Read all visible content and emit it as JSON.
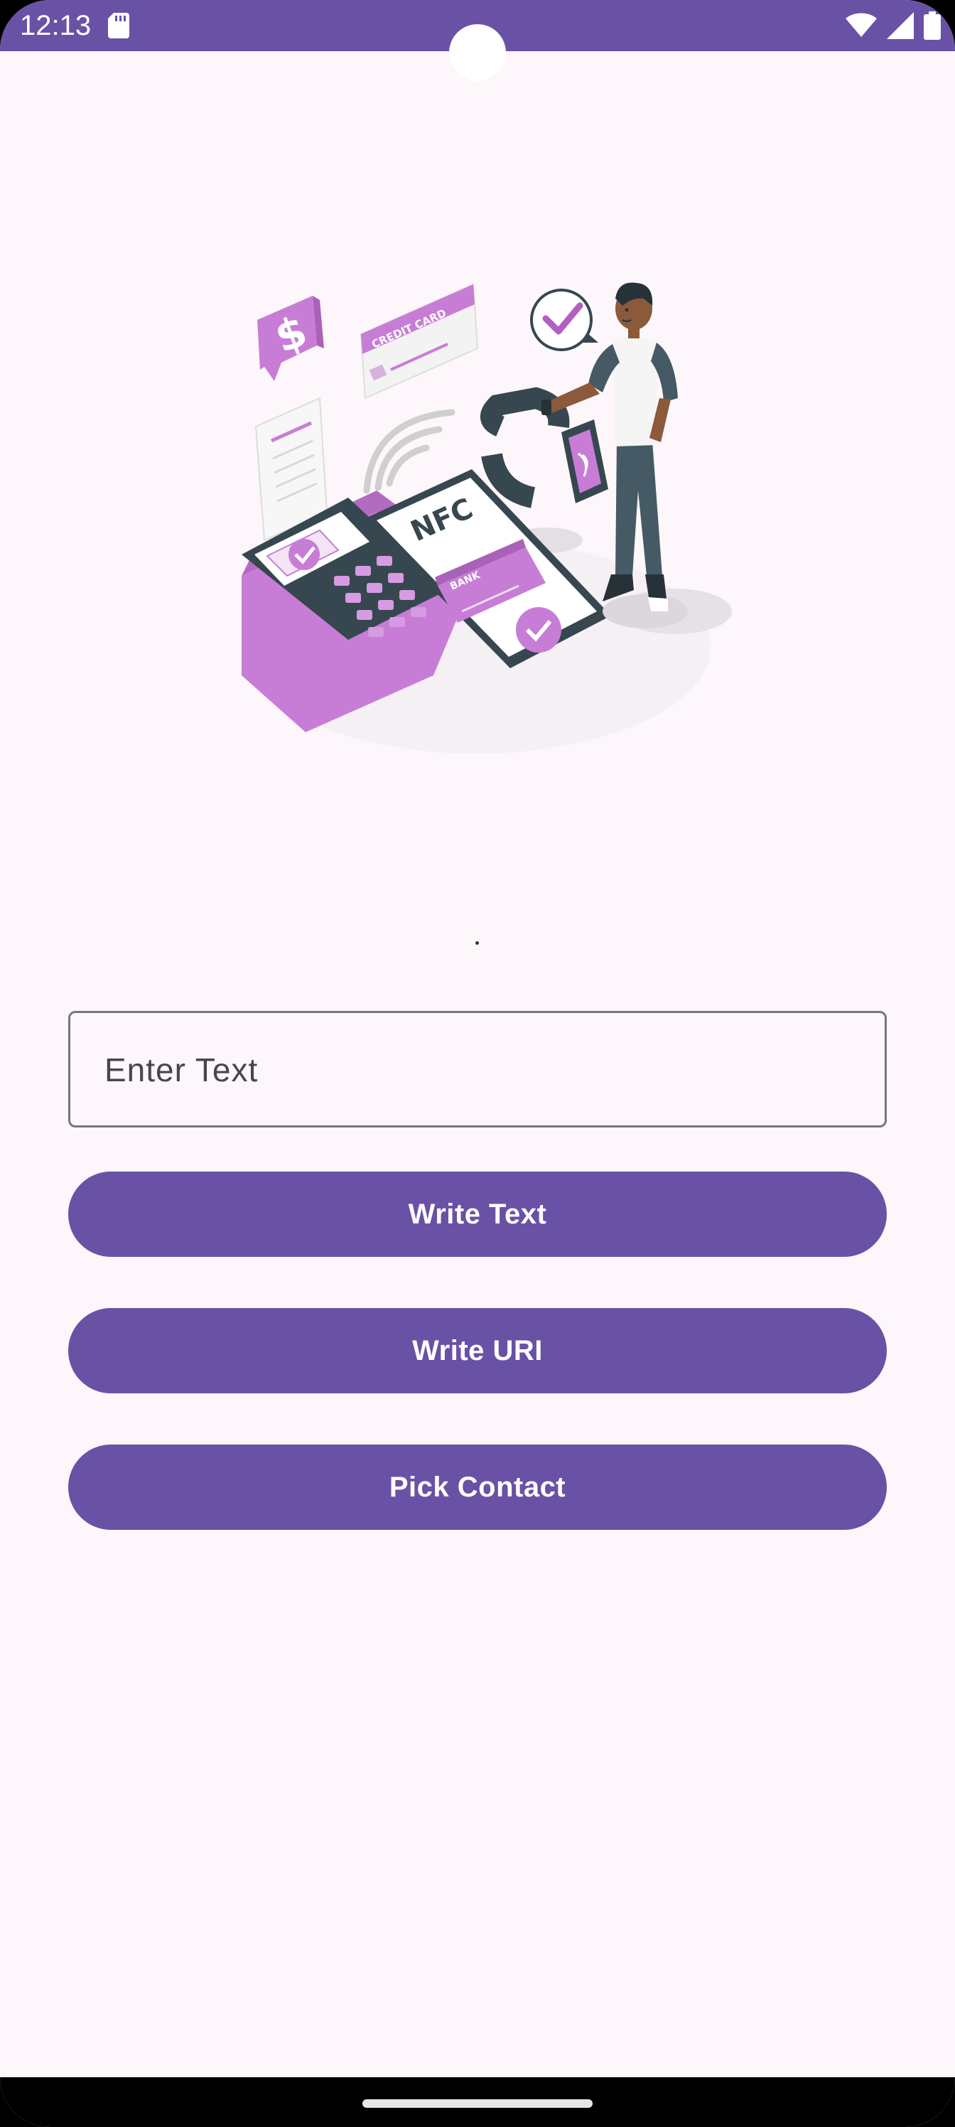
{
  "status_bar": {
    "time": "12:13",
    "icons": [
      "sd-card-icon",
      "wifi-icon",
      "signal-icon",
      "battery-icon"
    ],
    "background": "#6951a6"
  },
  "illustration": {
    "icon": "nfc-payment-illustration",
    "nfc_label": "NFC",
    "card_label": "CREDIT CARD",
    "bank_label": "BANK",
    "currency_symbol": "$"
  },
  "main": {
    "input": {
      "placeholder": "Enter Text",
      "value": ""
    },
    "buttons": {
      "write_text": "Write Text",
      "write_uri": "Write URI",
      "pick_contact": "Pick Contact"
    }
  },
  "colors": {
    "accent": "#6951a6",
    "background": "#fdf6fb",
    "illustration_purple": "#c77dd5",
    "illustration_dark": "#37474f"
  }
}
